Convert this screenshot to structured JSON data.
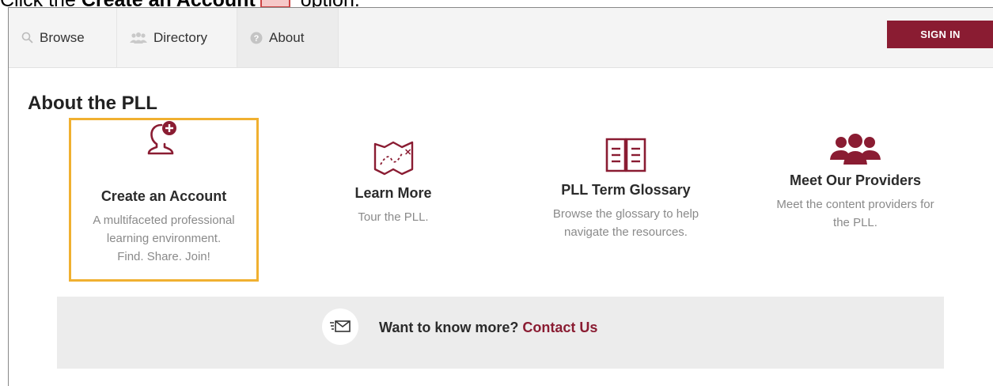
{
  "instruction": {
    "prefix": "Click the ",
    "bold": "Create an Account",
    "suffix": " option."
  },
  "nav": {
    "tabs": [
      {
        "label": "Browse",
        "icon": "search-icon"
      },
      {
        "label": "Directory",
        "icon": "people-icon"
      },
      {
        "label": "About",
        "icon": "question-icon"
      }
    ],
    "sign_in": "SIGN IN"
  },
  "page": {
    "title": "About the PLL"
  },
  "cards": [
    {
      "heading": "Create an Account",
      "desc_lines": [
        "A multifaceted professional",
        "learning environment.",
        "Find. Share. Join!"
      ],
      "icon": "add-user-icon"
    },
    {
      "heading": "Learn More",
      "desc_lines": [
        "Tour the PLL."
      ],
      "icon": "map-icon"
    },
    {
      "heading": "PLL Term Glossary",
      "desc_lines": [
        "Browse the glossary to help",
        "navigate the resources."
      ],
      "icon": "book-icon"
    },
    {
      "heading": "Meet Our Providers",
      "desc_lines": [
        "Meet the content providers for",
        "the PLL."
      ],
      "icon": "group-icon"
    }
  ],
  "banner": {
    "text": "Want to know more?",
    "link": "Contact Us",
    "icon": "mail-icon"
  },
  "colors": {
    "brand": "#8a1c32",
    "highlight": "#f0b030"
  }
}
